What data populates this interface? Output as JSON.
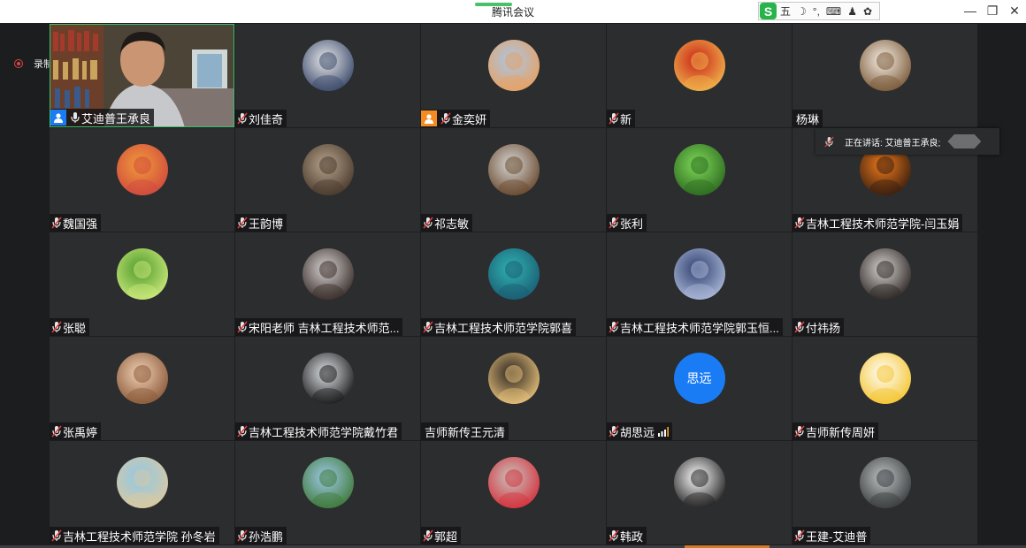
{
  "window": {
    "title": "腾讯会议"
  },
  "ime_toolbar": {
    "logo": "S",
    "items": [
      "五",
      "☽",
      "°,",
      "⌨",
      "♟",
      "✿"
    ]
  },
  "recording": {
    "label": "录制中"
  },
  "speaking_indicator": {
    "text": "正在讲话: 艾迪普王承良;"
  },
  "participants": [
    {
      "name": "艾迪普王承良",
      "role": "host",
      "mic": "on",
      "video": true
    },
    {
      "name": "刘佳奇",
      "mic": "muted",
      "avatar_icon": "anime-boy-avatar",
      "avatar_colors": [
        "#e9e9ea",
        "#3b4a6b"
      ]
    },
    {
      "name": "金奕妍",
      "role": "cohost",
      "mic": "muted",
      "avatar_icon": "figurines-avatar",
      "avatar_colors": [
        "#a9c7e8",
        "#e7a163"
      ]
    },
    {
      "name": "新",
      "mic": "muted",
      "avatar_icon": "red-pattern-avatar",
      "avatar_colors": [
        "#c9241a",
        "#f0b24a"
      ]
    },
    {
      "name": "杨琳",
      "mic": "none",
      "avatar_icon": "cartoon-girl-avatar",
      "avatar_colors": [
        "#f6efe4",
        "#7b5a3a"
      ]
    },
    {
      "name": "魏国强",
      "mic": "muted",
      "avatar_icon": "toast-avatar",
      "avatar_colors": [
        "#f09b3a",
        "#d14a3e"
      ]
    },
    {
      "name": "王韵博",
      "mic": "muted",
      "avatar_icon": "couple-photo-avatar",
      "avatar_colors": [
        "#b7a48d",
        "#4a3a2d"
      ]
    },
    {
      "name": "祁志敏",
      "mic": "muted",
      "avatar_icon": "woman-photo-avatar",
      "avatar_colors": [
        "#d8d8d8",
        "#6a4a2e"
      ]
    },
    {
      "name": "张利",
      "mic": "muted",
      "avatar_icon": "frog-avatar",
      "avatar_colors": [
        "#7ed957",
        "#2e6b22"
      ]
    },
    {
      "name": "吉林工程技术师范学院-闫玉娟",
      "mic": "muted",
      "avatar_icon": "flower-silhouette-avatar",
      "avatar_colors": [
        "#f07a1a",
        "#3a1f10"
      ]
    },
    {
      "name": "张聪",
      "mic": "muted",
      "avatar_icon": "forest-avatar",
      "avatar_colors": [
        "#4f9a2b",
        "#c9e87a"
      ]
    },
    {
      "name": "宋阳老师    吉林工程技术师范...",
      "mic": "muted",
      "avatar_icon": "boy-portrait-avatar",
      "avatar_colors": [
        "#d6d3d3",
        "#3a2e2a"
      ]
    },
    {
      "name": "吉林工程技术师范学院郭喜",
      "mic": "muted",
      "avatar_icon": "monster-avatar",
      "avatar_colors": [
        "#2fb3b0",
        "#1b5d74"
      ]
    },
    {
      "name": "吉林工程技术师范学院郭玉恒...",
      "mic": "muted",
      "avatar_icon": "anime-blue-avatar",
      "avatar_colors": [
        "#2e3f6e",
        "#aab7d8"
      ]
    },
    {
      "name": "付祎扬",
      "mic": "muted",
      "avatar_icon": "girl-cap-avatar",
      "avatar_colors": [
        "#d9d3cf",
        "#2d2826"
      ]
    },
    {
      "name": "张禹婷",
      "mic": "muted",
      "avatar_icon": "baby-avatar",
      "avatar_colors": [
        "#f2d0b4",
        "#8a5a3a"
      ]
    },
    {
      "name": "吉林工程技术师范学院戴竹君",
      "mic": "muted",
      "avatar_icon": "sunglasses-avatar",
      "avatar_colors": [
        "#dfe3e6",
        "#1c1c1e"
      ]
    },
    {
      "name": "吉师新传王元清",
      "mic": "none",
      "avatar_icon": "blonde-woman-avatar",
      "avatar_colors": [
        "#2a2420",
        "#e6c07a"
      ]
    },
    {
      "name": "胡思远",
      "mic": "muted",
      "avatar_text": "思远",
      "signal": true,
      "avatar_colors": [
        "#1a7cf5",
        "#ffffff"
      ]
    },
    {
      "name": "吉师新传周妍",
      "mic": "muted",
      "avatar_icon": "cartoon-face-avatar",
      "avatar_colors": [
        "#ffffff",
        "#f4c531"
      ]
    },
    {
      "name": "吉林工程技术师范学院 孙冬岩",
      "mic": "muted",
      "avatar_icon": "beach-avatar",
      "avatar_colors": [
        "#8fc7ea",
        "#d9c9a0"
      ]
    },
    {
      "name": "孙浩鹏",
      "mic": "muted",
      "avatar_icon": "landscape-avatar",
      "avatar_colors": [
        "#9fc9e8",
        "#3f7a3a"
      ]
    },
    {
      "name": "郭超",
      "mic": "muted",
      "avatar_icon": "child-bike-avatar",
      "avatar_colors": [
        "#c8c4bd",
        "#d4333f"
      ]
    },
    {
      "name": "韩政",
      "mic": "muted",
      "avatar_icon": "manga-avatar",
      "avatar_colors": [
        "#ffffff",
        "#222222"
      ]
    },
    {
      "name": "王建-艾迪普",
      "mic": "muted",
      "avatar_icon": "corridor-avatar",
      "avatar_colors": [
        "#bfc3c4",
        "#3a3d3f"
      ]
    }
  ]
}
